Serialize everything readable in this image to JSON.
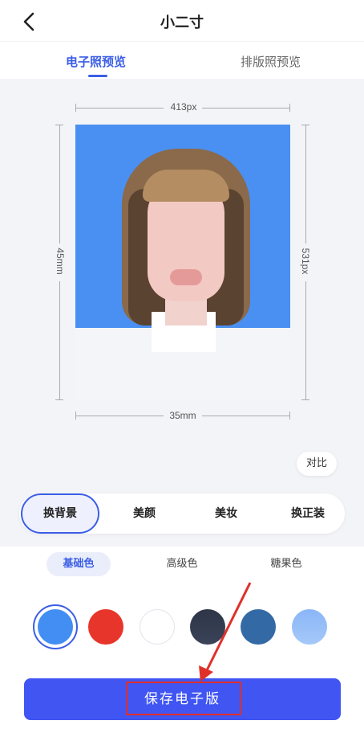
{
  "header": {
    "title": "小二寸"
  },
  "tabs": [
    {
      "label": "电子照预览",
      "active": true
    },
    {
      "label": "排版照预览",
      "active": false
    }
  ],
  "dimensions": {
    "width_px": "413px",
    "height_px": "531px",
    "width_mm": "35mm",
    "height_mm": "45mm"
  },
  "compare_label": "对比",
  "tools": [
    {
      "label": "换背景",
      "active": true
    },
    {
      "label": "美颜",
      "active": false
    },
    {
      "label": "美妆",
      "active": false
    },
    {
      "label": "换正装",
      "active": false
    }
  ],
  "color_tabs": [
    {
      "label": "基础色",
      "active": true
    },
    {
      "label": "高级色",
      "active": false
    },
    {
      "label": "糖果色",
      "active": false
    }
  ],
  "swatches": [
    {
      "color": "#438ef2",
      "selected": true
    },
    {
      "color": "#e8352b",
      "selected": false
    },
    {
      "color": "#ffffff",
      "selected": false
    },
    {
      "color": "#3a4358",
      "selected": false
    },
    {
      "color": "#336aa6",
      "selected": false
    },
    {
      "color": "#a5c8f9",
      "selected": false
    }
  ],
  "save_button": {
    "label": "保存电子版"
  },
  "colors": {
    "accent": "#3b5ee6",
    "button": "#4055f2",
    "annotation": "#e0302a"
  }
}
